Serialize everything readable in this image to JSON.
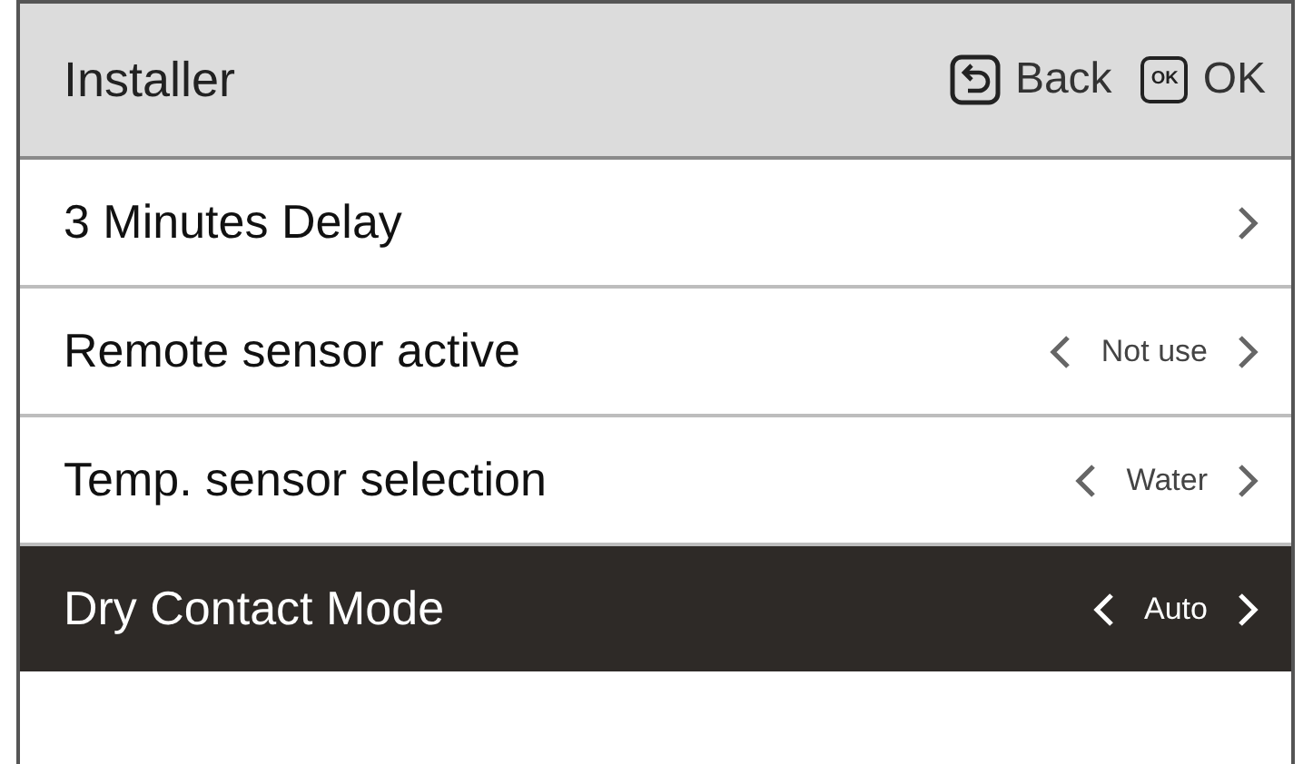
{
  "header": {
    "title": "Installer",
    "back_label": "Back",
    "ok_key": "OK",
    "ok_label": "OK"
  },
  "rows": [
    {
      "kind": "link",
      "label": "3 Minutes Delay",
      "selected": false
    },
    {
      "kind": "option",
      "label": "Remote sensor active",
      "value": "Not use",
      "selected": false
    },
    {
      "kind": "option",
      "label": "Temp. sensor selection",
      "value": "Water",
      "selected": false
    },
    {
      "kind": "option",
      "label": "Dry Contact Mode",
      "value": "Auto",
      "selected": true
    }
  ]
}
